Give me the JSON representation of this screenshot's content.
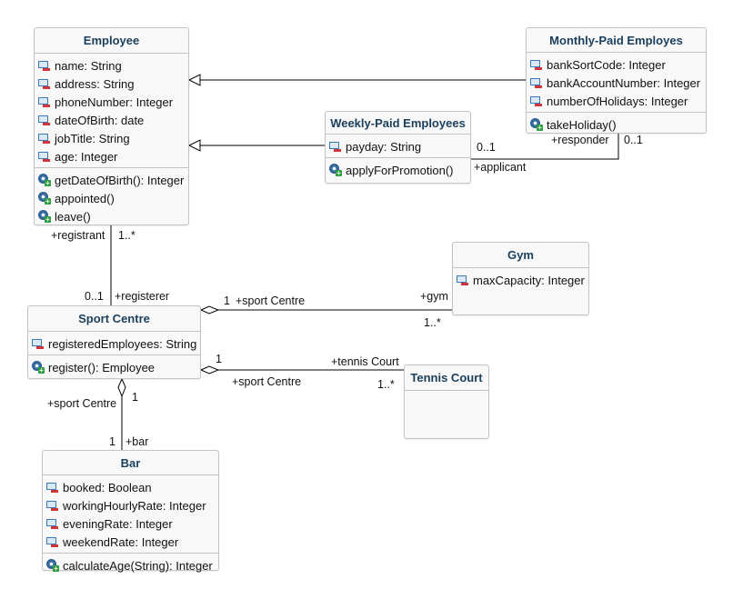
{
  "classes": [
    {
      "id": "employee",
      "title": "Employee",
      "attributes": [
        "name: String",
        "address: String",
        "phoneNumber: Integer",
        "dateOfBirth: date",
        "jobTitle: String",
        "age: Integer"
      ],
      "operations": [
        "getDateOfBirth(): Integer",
        "appointed()",
        "leave()"
      ]
    },
    {
      "id": "monthly",
      "title": "Monthly-Paid Employes",
      "attributes": [
        "bankSortCode: Integer",
        "bankAccountNumber: Integer",
        "numberOfHolidays: Integer"
      ],
      "operations": [
        "takeHoliday()"
      ]
    },
    {
      "id": "weekly",
      "title": "Weekly-Paid Employees",
      "attributes": [
        "payday: String"
      ],
      "operations": [
        "applyForPromotion()"
      ]
    },
    {
      "id": "gym",
      "title": "Gym",
      "attributes": [
        "maxCapacity: Integer"
      ],
      "operations": []
    },
    {
      "id": "sport",
      "title": "Sport Centre",
      "attributes": [
        "registeredEmployees: String"
      ],
      "operations": [
        "register(): Employee"
      ]
    },
    {
      "id": "tennis",
      "title": "Tennis Court",
      "attributes": [],
      "operations": []
    },
    {
      "id": "bar",
      "title": "Bar",
      "attributes": [
        "booked: Boolean",
        "workingHourlyRate: Integer",
        "eveningRate: Integer",
        "weekendRate: Integer"
      ],
      "operations": [
        "calculateAge(String): Integer"
      ]
    }
  ],
  "relations": [
    {
      "type": "generalization",
      "from": "monthly",
      "to": "employee"
    },
    {
      "type": "generalization",
      "from": "weekly",
      "to": "employee"
    },
    {
      "type": "association",
      "from": "weekly",
      "to": "monthly"
    },
    {
      "type": "association",
      "from": "employee",
      "to": "sport"
    },
    {
      "type": "aggregation",
      "from": "gym",
      "to": "sport"
    },
    {
      "type": "aggregation",
      "from": "tennis",
      "to": "sport"
    },
    {
      "type": "aggregation",
      "from": "bar",
      "to": "sport"
    }
  ],
  "labels": [
    "0..1",
    "+applicant",
    "+responder",
    "0..1",
    "+registrant",
    "1..*",
    "0..1",
    "+registerer",
    "1",
    "+sport Centre",
    "+gym",
    "1..*",
    "1",
    "+tennis Court",
    "+sport Centre",
    "1..*",
    "+sport Centre",
    "1",
    "1",
    "+bar"
  ],
  "colors": {
    "title": "#1a3f5c",
    "border": "#c4c4c4",
    "fill": "#f8f8f8",
    "line": "#000000"
  }
}
